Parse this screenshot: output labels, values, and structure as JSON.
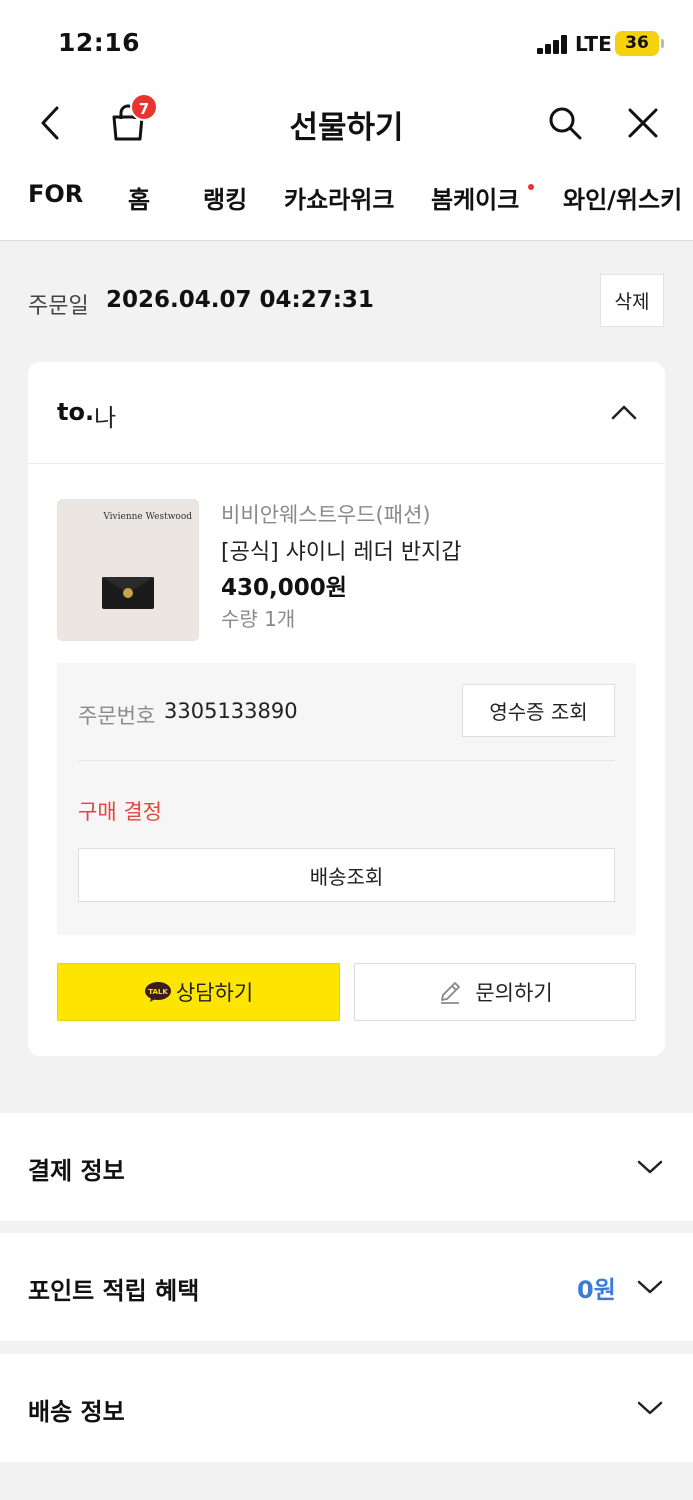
{
  "status_bar": {
    "time": "12:16",
    "network": "LTE",
    "battery": "36"
  },
  "header": {
    "title": "선물하기",
    "cart_count": "7"
  },
  "tabs": [
    {
      "label": "FOR"
    },
    {
      "label": "홈"
    },
    {
      "label": "랭킹"
    },
    {
      "label": "카쇼라위크"
    },
    {
      "label": "봄케이크",
      "has_dot": true
    },
    {
      "label": "와인/위스키"
    }
  ],
  "order": {
    "date_label": "주문일",
    "date": "2026.04.07 04:27:31",
    "delete_label": "삭제"
  },
  "card": {
    "to_prefix": "to.",
    "recipient": "나",
    "product": {
      "thumb_brand": "Vivienne Westwood",
      "brand": "비비안웨스트우드(패션)",
      "name": "[공식] 샤이니 레더 반지갑",
      "price": "430,000원",
      "quantity": "수량 1개"
    },
    "order_number_label": "주문번호",
    "order_number": "3305133890",
    "receipt_label": "영수증 조회",
    "status": "구매 결정",
    "shipping_button": "배송조회",
    "consult_button": "상담하기",
    "talk_badge": "TALK",
    "inquiry_button": "문의하기"
  },
  "sections": {
    "payment": {
      "title": "결제 정보"
    },
    "points": {
      "title": "포인트 적립 혜택",
      "value": "0원"
    },
    "shipping": {
      "title": "배송 정보"
    }
  },
  "colors": {
    "accent_yellow": "#fee500",
    "status_red": "#e2473b",
    "point_blue": "#3d7bd6",
    "badge_red": "#e8342f"
  }
}
